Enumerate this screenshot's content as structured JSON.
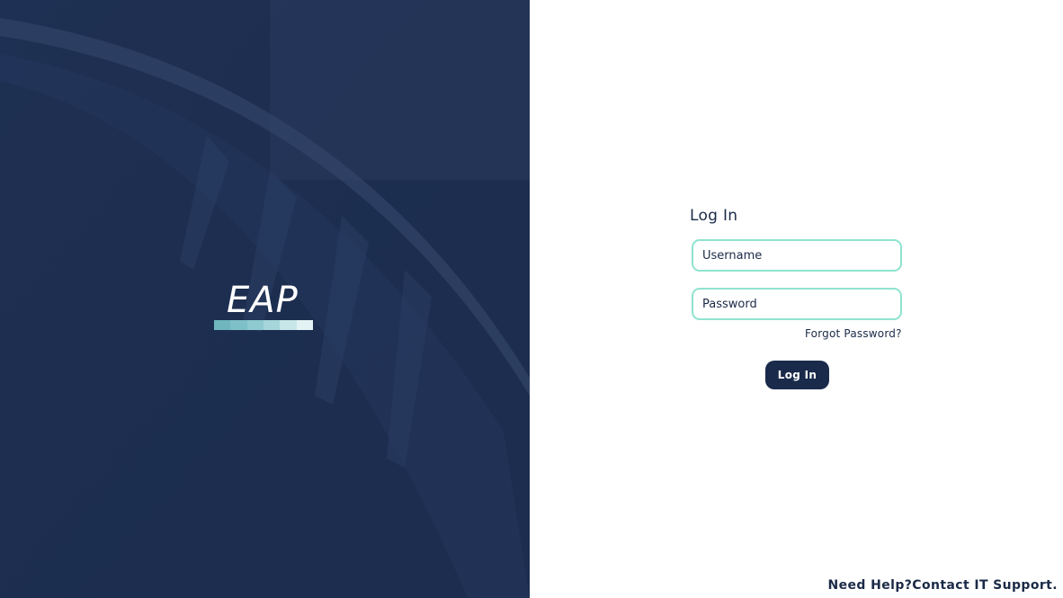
{
  "brand": {
    "logo_text": "EAP",
    "bar_colors": [
      "#6fb6bf",
      "#7ec0c8",
      "#8ecad0",
      "#a6d6da",
      "#c7e6e8",
      "#e3f2f3"
    ]
  },
  "login": {
    "title": "Log In",
    "username_placeholder": "Username",
    "password_placeholder": "Password",
    "forgot_label": "Forgot Password?",
    "submit_label": "Log In"
  },
  "footer": {
    "help_prefix": "Need Help?",
    "help_link": "Contact IT Support."
  },
  "colors": {
    "panel": "#1a2a4b",
    "field_border": "#8fe3cf",
    "text": "#1b2a47"
  }
}
